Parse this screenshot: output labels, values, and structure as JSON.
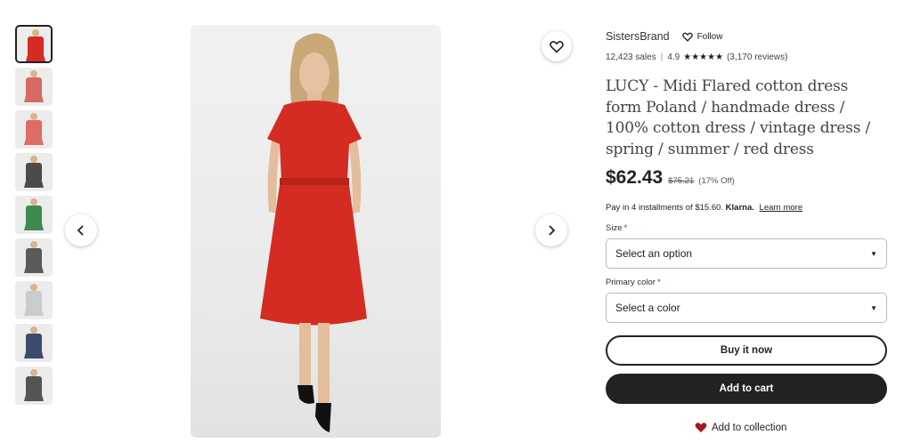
{
  "thumbnails": [
    {
      "name": "red",
      "color": "#d62b22",
      "active": true
    },
    {
      "name": "coral",
      "color": "#d76a63",
      "active": false
    },
    {
      "name": "coral-2",
      "color": "#dd6d66",
      "active": false
    },
    {
      "name": "charcoal",
      "color": "#4a4a4a",
      "active": false
    },
    {
      "name": "green",
      "color": "#3f8a4d",
      "active": false
    },
    {
      "name": "dark-grey",
      "color": "#5a5a5a",
      "active": false
    },
    {
      "name": "light-grey",
      "color": "#c9cbcc",
      "active": false
    },
    {
      "name": "navy",
      "color": "#3d4a6b",
      "active": false
    },
    {
      "name": "graphite",
      "color": "#555555",
      "active": false
    }
  ],
  "product_image": {
    "dress_color": "#d42c22",
    "alt": "red midi dress"
  },
  "shop": {
    "name": "SistersBrand",
    "follow_label": "Follow"
  },
  "stats": {
    "sales": "12,423 sales",
    "rating": "4.9",
    "stars": "★★★★★",
    "reviews": "(3,170 reviews)"
  },
  "title": "LUCY - Midi Flared cotton dress form Poland / handmade dress / 100% cotton dress / vintage dress / spring / summer / red dress",
  "price": {
    "current": "$62.43",
    "original": "$75.21",
    "discount": "(17% Off)"
  },
  "klarna": {
    "text": "Pay in 4 installments of $15.60.",
    "brand": "Klarna.",
    "link": "Learn more"
  },
  "size": {
    "label": "Size",
    "required": "*",
    "value": "Select an option"
  },
  "color": {
    "label": "Primary color",
    "required": "*",
    "value": "Select a color"
  },
  "buttons": {
    "buy_now": "Buy it now",
    "add_to_cart": "Add to cart",
    "add_to_collection": "Add to collection"
  },
  "colors": {
    "accent_dark": "#222222",
    "heart_red": "#a61a1a",
    "required_red": "#b3261e"
  }
}
